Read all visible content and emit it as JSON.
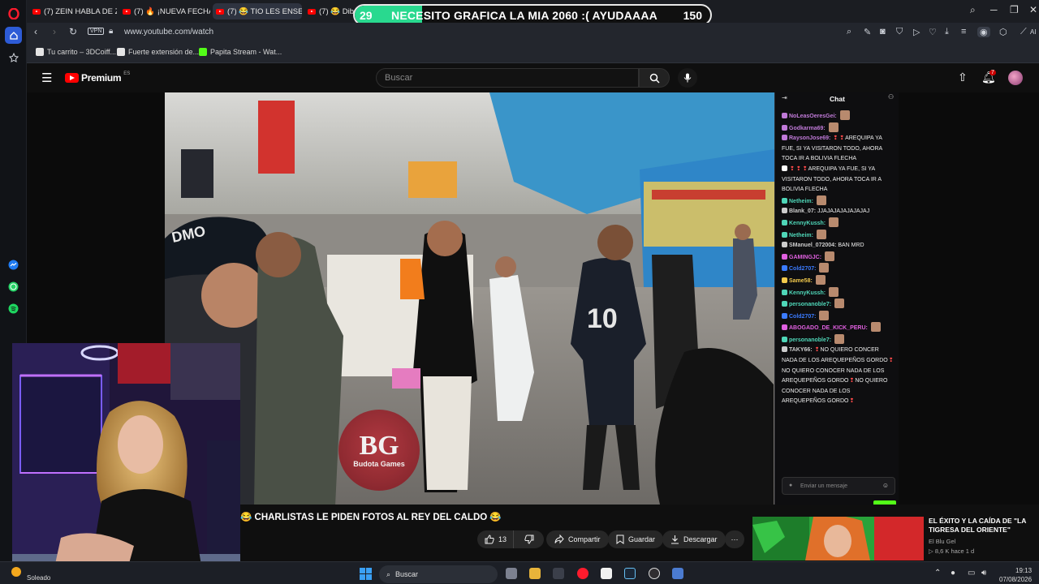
{
  "browser": {
    "tabs": [
      {
        "label": "(7) ZEIN HABLA DE ZULLY",
        "active": false
      },
      {
        "label": "(7) 🔥 ¡NUEVA FECHA par",
        "active": false
      },
      {
        "label": "(7) 😂 TIO LES ENSEÑA G",
        "active": true
      },
      {
        "label": "(7) 😂 Dibujit",
        "active": false
      }
    ],
    "vpn_label": "VPN",
    "url": "www.youtube.com/watch",
    "ai_label": "AI",
    "bookmarks": [
      {
        "label": "Tu carrito – 3DCoiff...",
        "color": "#e4e4e4"
      },
      {
        "label": "Fuerte extensión de...",
        "color": "#e4e4e4"
      },
      {
        "label": "Papita Stream - Wat...",
        "color": "#53fc18"
      }
    ]
  },
  "overlay_banner": {
    "current": "29",
    "text": "NECESITO GRAFICA LA MIA 2060 :( AYUDAAAA",
    "goal": "150",
    "progress_fraction": 0.19
  },
  "youtube": {
    "brand": "Premium",
    "country": "ES",
    "search_placeholder": "Buscar",
    "notif_count": "7"
  },
  "watermark": {
    "initials": "BG",
    "name": "Budota Games"
  },
  "chat": {
    "title": "Chat",
    "input_placeholder": "Enviar un mensaje",
    "messages": [
      {
        "user": "NoLeasOeresGei:",
        "color": "#c07ad8",
        "text": "",
        "emotes": 1
      },
      {
        "user": "Godkarma69:",
        "color": "#c07ad8",
        "text": "",
        "emotes": 1
      },
      {
        "user": "RaysonJose69:",
        "color": "#c07ad8",
        "text": "AREQUIPA YA FUE, SI YA VISITARON TODO, AHORA TOCA IR A BOLIVIA FLECHA",
        "drops": 2
      },
      {
        "user": "",
        "color": "#ffffff",
        "text": "AREQUIPA YA FUE, SI YA VISITARON TODO, AHORA TOCA IR A BOLIVIA FLECHA",
        "drops": 3
      },
      {
        "user": "Netheim:",
        "color": "#4fd6b8",
        "text": "",
        "emotes": 1
      },
      {
        "user": "Blank_07:",
        "color": "#cccccc",
        "text": "JJAJAJAJAJAJAJAJ"
      },
      {
        "user": "KennyKussh:",
        "color": "#4fd6b8",
        "text": "",
        "emotes": 1
      },
      {
        "user": "Netheim:",
        "color": "#4fd6b8",
        "text": "",
        "emotes": 1
      },
      {
        "user": "SManuel_072004:",
        "color": "#cccccc",
        "text": "BAN MRD"
      },
      {
        "user": "GAMINGJC:",
        "color": "#e060e0",
        "text": "",
        "emotes": 1
      },
      {
        "user": "Cold2707:",
        "color": "#3b7bff",
        "text": "",
        "emotes": 1
      },
      {
        "user": "Same58:",
        "color": "#f2c94c",
        "text": "",
        "emotes": 1
      },
      {
        "user": "KennyKussh:",
        "color": "#4fd6b8",
        "text": "",
        "emotes": 1
      },
      {
        "user": "personanoble7:",
        "color": "#4fd6b8",
        "text": "",
        "emotes": 1
      },
      {
        "user": "Cold2707:",
        "color": "#3b7bff",
        "text": "",
        "emotes": 1
      },
      {
        "user": "ABOGADO_DE_KICK_PERU:",
        "color": "#e060e0",
        "text": "",
        "emotes": 1
      },
      {
        "user": "personanoble7:",
        "color": "#4fd6b8",
        "text": "",
        "emotes": 1
      },
      {
        "user": "TAKY66:",
        "color": "#cccccc",
        "text": "NO QUIERO CONCER NADA DE LOS AREQUEPEÑOS GORDO",
        "drops": 1,
        "extra": "NO QUIERO CONOCER NADA DE LOS AREQUEPEÑOS GORDO",
        "extra2": "NO QUIERO CONOCER NADA DE LOS AREQUEPEÑOS GORDO"
      }
    ]
  },
  "video": {
    "title": "😂 CHARLISTAS LE PIDEN FOTOS AL REY DEL CALDO 😂",
    "like_count": "13",
    "share_label": "Compartir",
    "save_label": "Guardar",
    "download_label": "Descargar"
  },
  "recommended": {
    "title": "EL ÉXITO Y LA CAÍDA DE \"LA TIGRESA DEL ORIENTE\"",
    "channel": "El Blu Gel",
    "meta": "▷ 8,6 K  hace 1 d"
  },
  "taskbar": {
    "weather": "Soleado",
    "search_label": "Buscar",
    "time": "19:13",
    "date": "07/08/2026"
  }
}
